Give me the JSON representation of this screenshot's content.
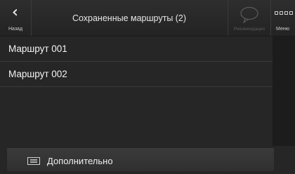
{
  "header": {
    "back_label": "Назад",
    "title": "Сохраненные маршруты (2)",
    "route_label": "Рекомендация",
    "menu_label": "Меню"
  },
  "routes": [
    {
      "name": "Маршрут 001"
    },
    {
      "name": "Маршрут 002"
    }
  ],
  "footer": {
    "more_label": "Дополнительно"
  },
  "icons": {
    "back": "double-chevron-left-icon",
    "route": "speech-bubble-icon",
    "menu": "grid-icon",
    "more": "list-icon"
  }
}
